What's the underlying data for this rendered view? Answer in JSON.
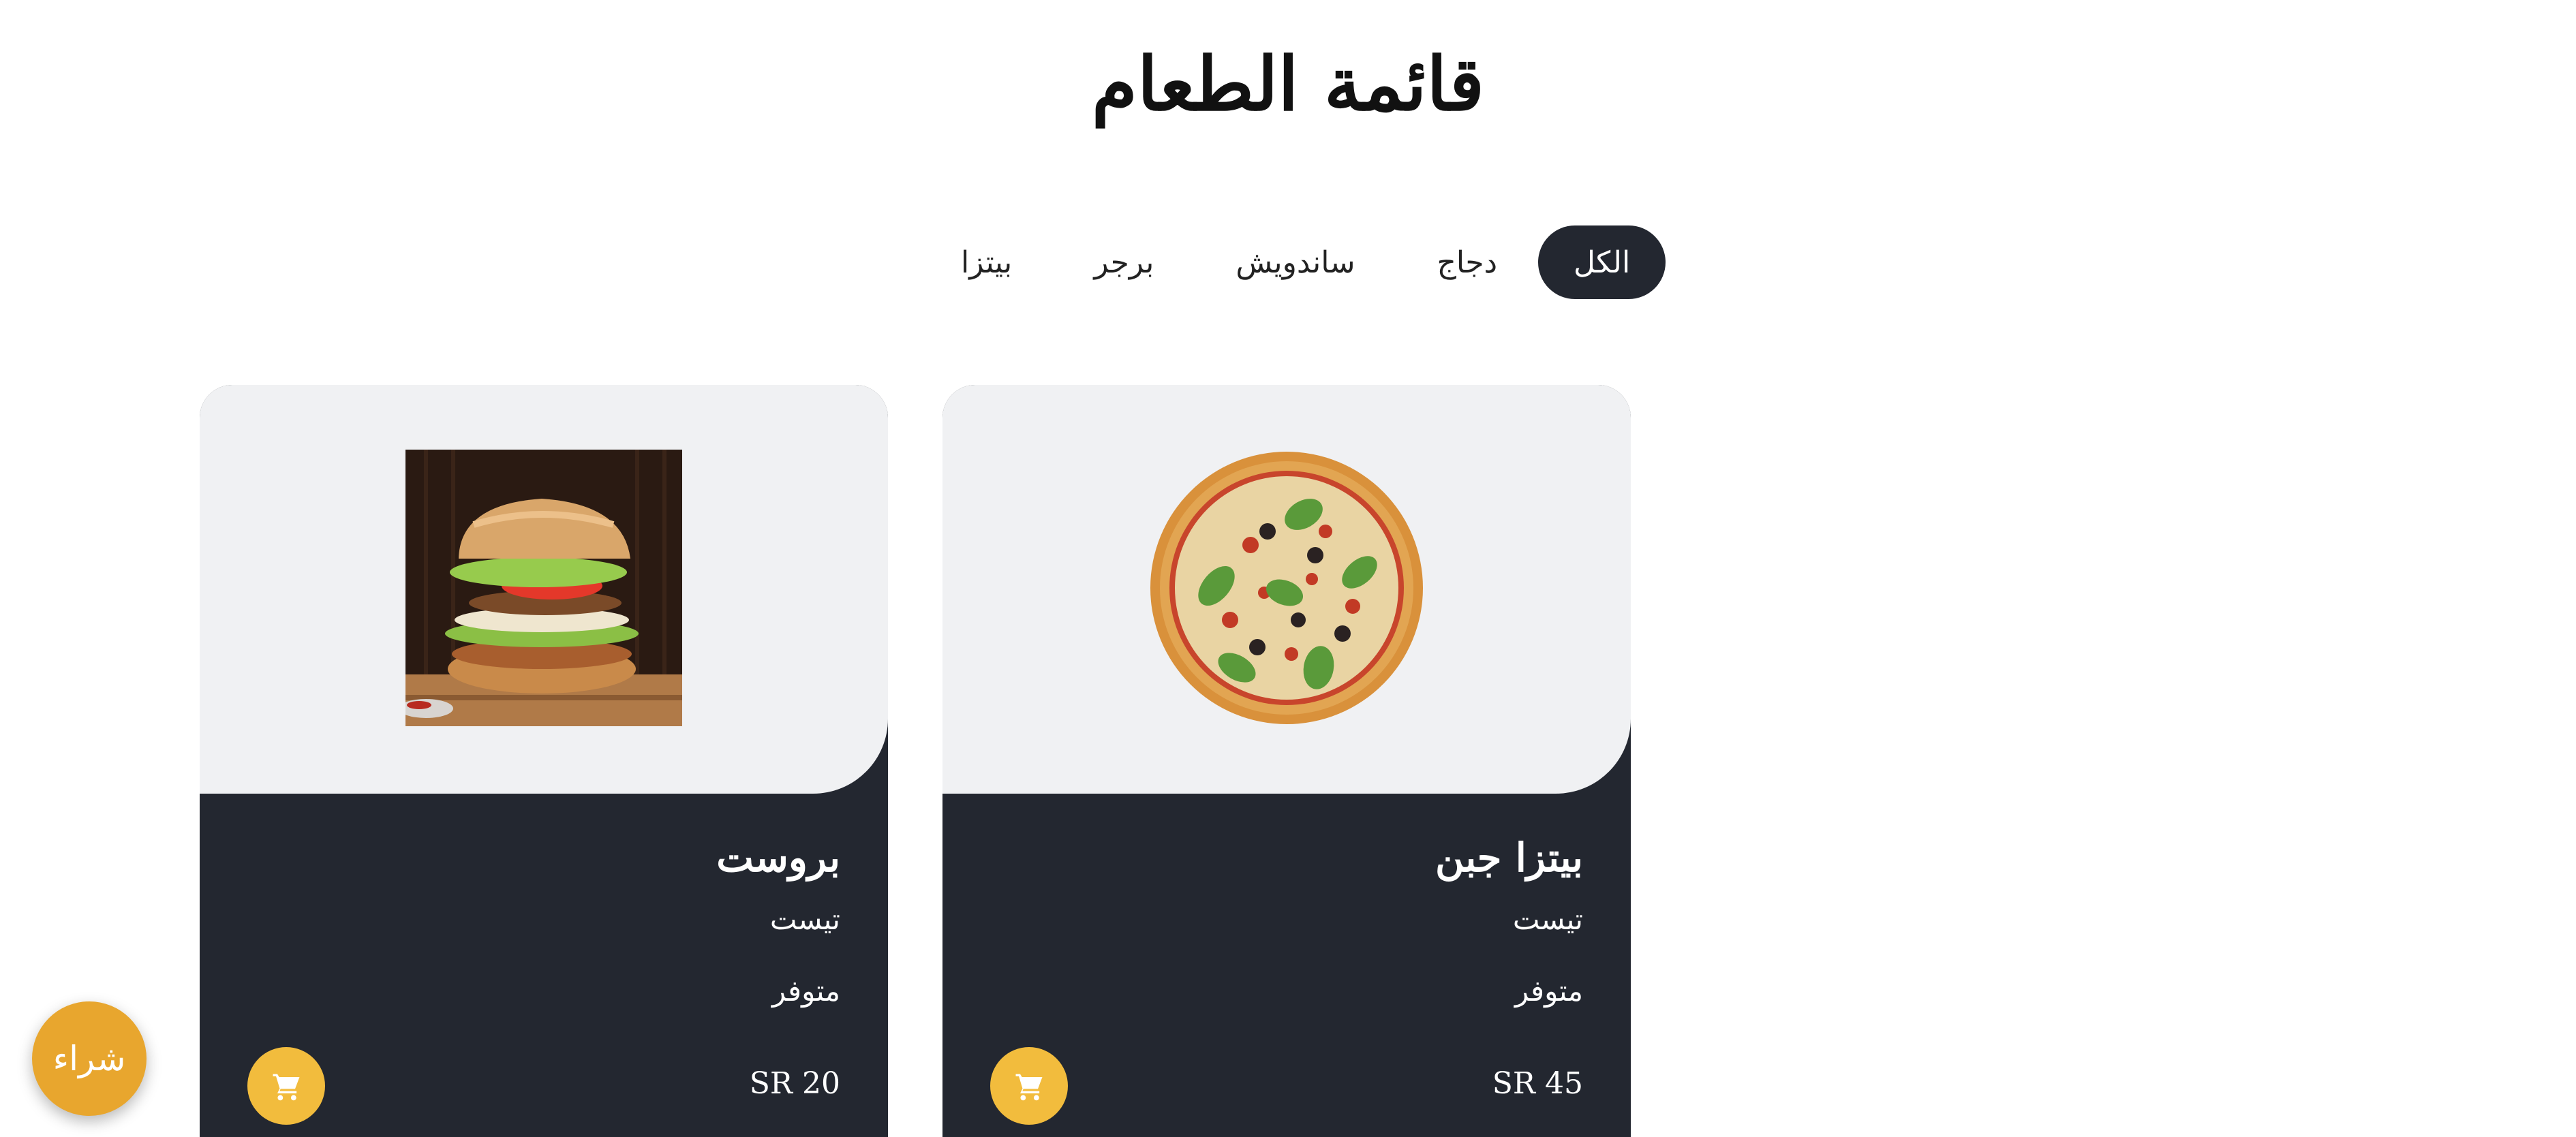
{
  "header": {
    "title": "قائمة الطعام"
  },
  "tabs": [
    {
      "label": "الكل",
      "active": true
    },
    {
      "label": "دجاج",
      "active": false
    },
    {
      "label": "ساندويش",
      "active": false
    },
    {
      "label": "برجر",
      "active": false
    },
    {
      "label": "بيتزا",
      "active": false
    }
  ],
  "products": [
    {
      "name": "بيتزا جبن",
      "description": "تيست",
      "status": "متوفر",
      "price": "SR 45",
      "image": "pizza",
      "cart_icon": "cart-icon"
    },
    {
      "name": "بروست",
      "description": "تيست",
      "status": "متوفر",
      "price": "SR 20",
      "image": "burger",
      "cart_icon": "cart-icon"
    }
  ],
  "fab": {
    "label": "شراء"
  },
  "colors": {
    "dark": "#232730",
    "card_top": "#f0f1f3",
    "accent": "#f2bc3d",
    "fab": "#e8a62e"
  }
}
